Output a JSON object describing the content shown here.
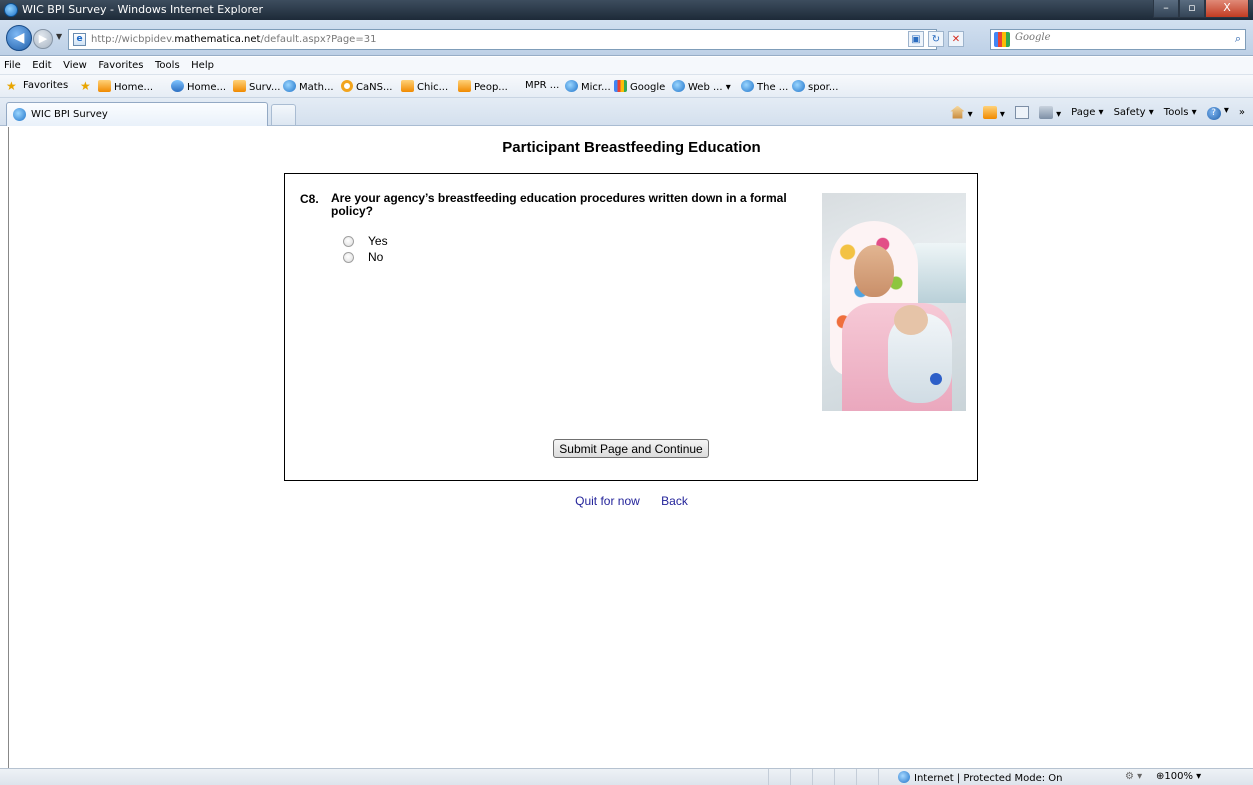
{
  "window": {
    "title": "WIC BPI Survey - Windows Internet Explorer",
    "minimize_glyph": "–",
    "maximize_glyph": "▫",
    "close_glyph": "X"
  },
  "nav": {
    "back_glyph": "◀",
    "forward_glyph": "▶",
    "dropdown_glyph": "▼"
  },
  "address": {
    "url_prefix": "http://wicbpidev.",
    "url_domain": "mathematica.net",
    "url_suffix": "/default.aspx?Page=31"
  },
  "search": {
    "placeholder": "Google",
    "go_glyph": "⌕"
  },
  "menu": {
    "items": [
      "File",
      "Edit",
      "View",
      "Favorites",
      "Tools",
      "Help"
    ]
  },
  "favorites": {
    "label": "Favorites",
    "items": [
      "Home...",
      "Home...",
      "Surv...",
      "Math...",
      "CaNS...",
      "Chic...",
      "Peop...",
      "MPR ...",
      "Micr...",
      "Google",
      "Web ...",
      "The ...",
      "spor..."
    ]
  },
  "tabs": {
    "active_label": "WIC BPI Survey"
  },
  "commandbar": {
    "page_label": "Page",
    "safety_label": "Safety",
    "tools_label": "Tools",
    "dropdown_glyph": "▾",
    "more_glyph": "»"
  },
  "content": {
    "heading": "Participant Breastfeeding Education",
    "question_number": "C8.",
    "question_text": "Are your agency’s breastfeeding education procedures written down in a formal policy?",
    "options": [
      "Yes",
      "No"
    ],
    "submit_label": "Submit Page and Continue",
    "quit_label": "Quit for now",
    "back_label": "Back"
  },
  "status": {
    "zone_text": "Internet | Protected Mode: On",
    "zoom_text": "100%",
    "zoom_glyph": "⊕",
    "dropdown_glyph": "▾"
  }
}
